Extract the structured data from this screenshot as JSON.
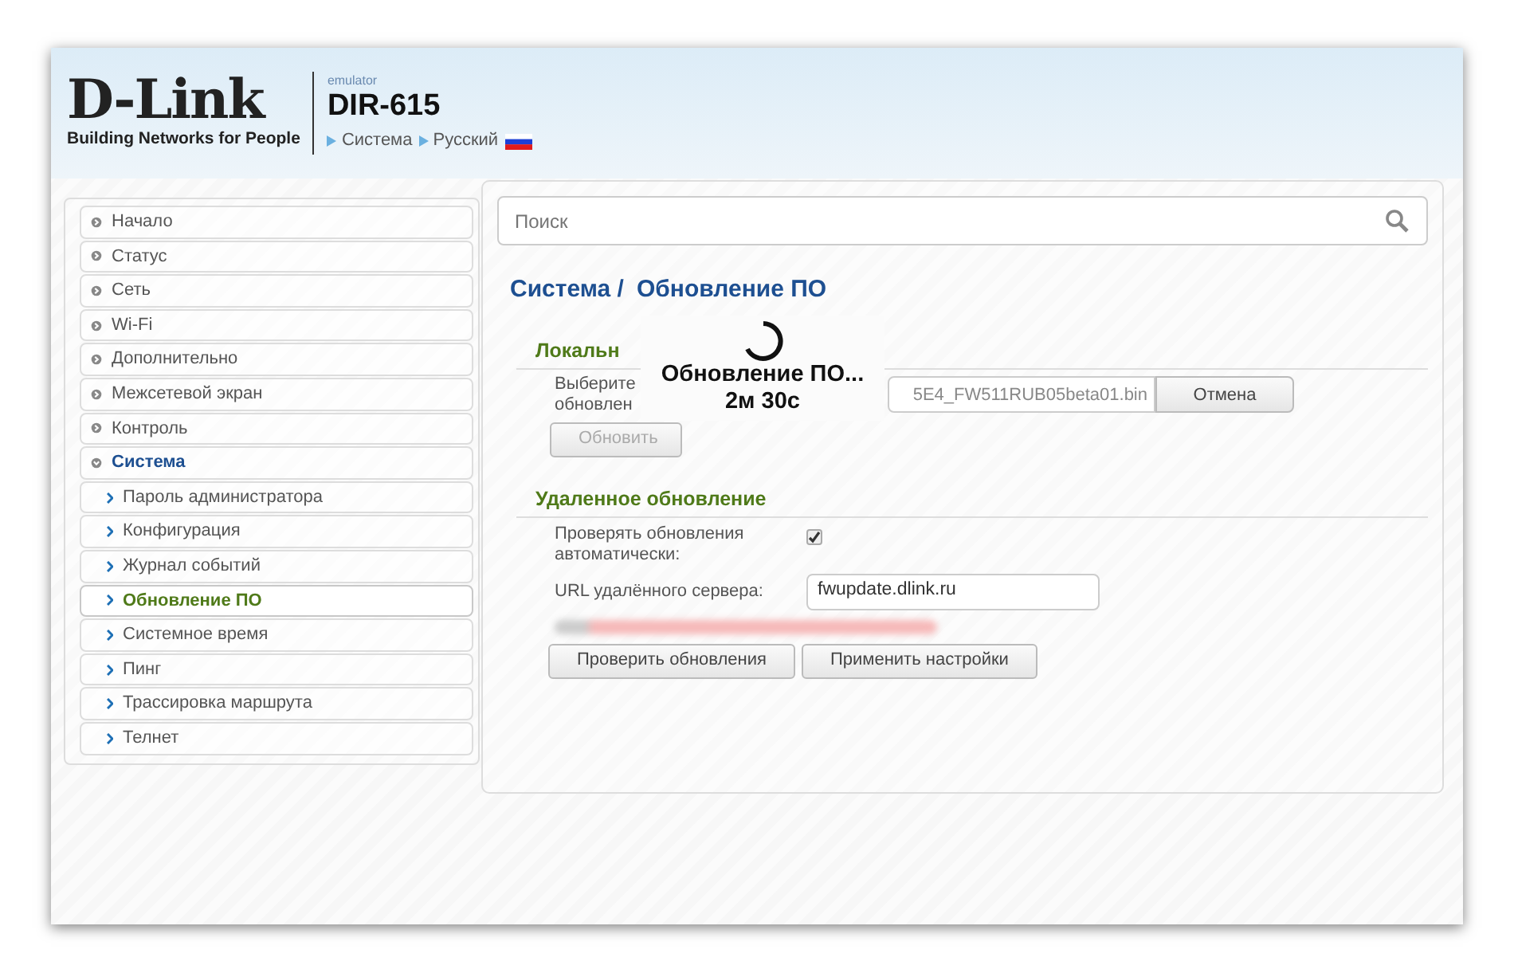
{
  "header": {
    "brand": "D-Link",
    "tagline": "Building Networks for People",
    "emulator": "emulator",
    "model": "DIR-615",
    "breadcrumb": [
      "Система",
      "Русский"
    ]
  },
  "search": {
    "placeholder": "Поиск"
  },
  "sidebar": [
    {
      "label": "Начало",
      "expanded": false,
      "selected": false
    },
    {
      "label": "Статус",
      "expanded": false,
      "selected": false
    },
    {
      "label": "Сеть",
      "expanded": false,
      "selected": false
    },
    {
      "label": "Wi-Fi",
      "expanded": false,
      "selected": false
    },
    {
      "label": "Дополнительно",
      "expanded": false,
      "selected": false
    },
    {
      "label": "Межсетевой экран",
      "expanded": false,
      "selected": false
    },
    {
      "label": "Контроль",
      "expanded": false,
      "selected": false
    },
    {
      "label": "Система",
      "expanded": true,
      "selected": false,
      "children": [
        {
          "label": "Пароль администратора",
          "selected": false
        },
        {
          "label": "Конфигурация",
          "selected": false
        },
        {
          "label": "Журнал событий",
          "selected": false
        },
        {
          "label": "Обновление ПО",
          "selected": true
        },
        {
          "label": "Системное время",
          "selected": false
        },
        {
          "label": "Пинг",
          "selected": false
        },
        {
          "label": "Трассировка маршрута",
          "selected": false
        },
        {
          "label": "Телнет",
          "selected": false
        }
      ]
    }
  ],
  "page_title": [
    "Система /",
    "Обновление ПО"
  ],
  "local": {
    "title": "Локальн",
    "file_label": [
      "Выберите",
      "обновлен"
    ],
    "file_name": "5E4_FW511RUB05beta01.bin",
    "cancel": "Отмена",
    "update": "Обновить",
    "update_disabled": true
  },
  "remote": {
    "title": "Удаленное обновление",
    "auto_label": "Проверять обновления автоматически:",
    "auto_checked": true,
    "url_label": "URL удалённого сервера:",
    "url": "fwupdate.dlink.ru",
    "buttons": [
      "Проверить обновления",
      "Применить настройки"
    ]
  },
  "overlay": {
    "title": "Обновление ПО...",
    "time": "2м 30с"
  }
}
